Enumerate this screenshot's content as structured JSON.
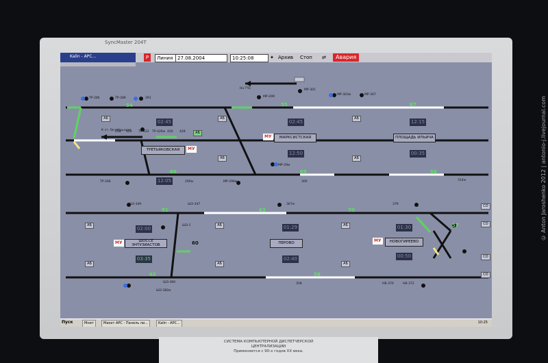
{
  "monitor": {
    "brand": "SyncMaster 204T"
  },
  "window": {
    "title": "Kalin - АРС..."
  },
  "toolbar": {
    "indicator": "P",
    "mode_label": "Линия",
    "date": "27.08.2004",
    "time": "10:25:08",
    "archive_label": "Архив",
    "stop_label": "Стоп",
    "alarm_label": "Авария"
  },
  "stations": {
    "tretyakovskaya": "ТРЕТЬЯКОВСКАЯ",
    "marksistskaya": "МАРКСИСТСКАЯ",
    "ploshchad_ilyicha": "ПЛОЩАДЬ ИЛЬИЧА",
    "shosse_entuziastov": "ШОССЕ ЭНТУЗИАСТОВ",
    "perovo": "ПЕРОВО",
    "novogireevo": "НОВОГИРЕЕВО"
  },
  "mu_label": "МУ",
  "clocks": {
    "c1": "02:45",
    "c2": "02:45",
    "c3": "12:15",
    "c4": "12:50",
    "c5": "00:35",
    "c6": "12:05",
    "c7": "02:00",
    "c8": "01:29",
    "c9": "01:30",
    "c10": "03:35",
    "c11": "02:40",
    "c12": "00:50"
  },
  "track_numbers": {
    "n54": "54",
    "n55": "55",
    "n67": "67",
    "n66": "66",
    "n69": "69",
    "n56": "56",
    "n51": "51",
    "n63": "63",
    "n70": "70",
    "n57": "57",
    "n60": "60",
    "n62": "62",
    "n58": "58"
  },
  "ab_label": "АБ",
  "co_label": "CO",
  "labels": {
    "na_tch": "На ТЧ1",
    "k_st": "К ст. Октябрьская",
    "tr285": "ТР-285",
    "tr289": "ТР-289",
    "l291": "291",
    "mr299": "МР-299",
    "mr301": "МР-301",
    "mr307": "МР-307",
    "mr303": "МР-303м",
    "tr422": "ТР-422",
    "tr426": "ТР-426м",
    "l426": "426",
    "l428": "428",
    "l418": "418",
    "l420": "420",
    "tr266": "ТР-266",
    "l290": "290м",
    "mr296": "МР-296м",
    "mr29": "МР-29м",
    "l300": "300",
    "l314": "314м",
    "sh347": "ШЭ-347",
    "sh349": "ШЭ-349",
    "l379": "379",
    "l367": "367м",
    "sh1": "ШЭ-1",
    "sh360": "ШЭ-360",
    "sh382": "ШЭ-382м",
    "l358": "358",
    "nv370": "НВ-370",
    "nv372": "НВ-372"
  },
  "taskbar": {
    "start": "Пуск",
    "items": [
      "Мнит",
      "Макет АРС - Панель ли...",
      "Kalin - АРС..."
    ],
    "clock": "10:25"
  },
  "plaque": {
    "line1": "СИСТЕМА КОМПЬЮТЕРНОЙ ДИСПЕТЧЕРСКОЙ",
    "line2": "ЦЕНТРАЛИЗАЦИИ",
    "line3": "Применяется с 90-х годов XX века."
  },
  "watermark": "© Anton Jaroshenko 2012 | antonio-j.livejournal.com"
}
